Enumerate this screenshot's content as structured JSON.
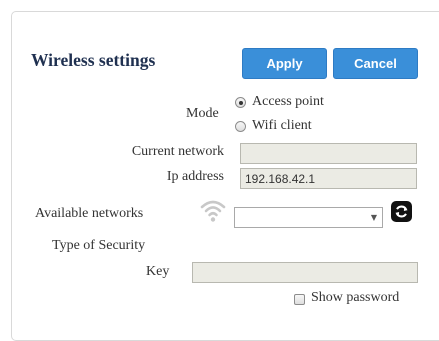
{
  "form": {
    "title": "Wireless settings",
    "apply_label": "Apply",
    "cancel_label": "Cancel",
    "mode_label": "Mode",
    "mode_options": [
      "Access point",
      "Wifi client"
    ],
    "mode_selected": "Access point",
    "current_network_label": "Current network",
    "current_network_value": "",
    "ip_address_label": "Ip address",
    "ip_address_value": "192.168.42.1",
    "available_networks_label": "Available networks",
    "available_networks_selected": "",
    "security_label": "Type of Security",
    "key_label": "Key",
    "key_value": "",
    "show_password_label": "Show password"
  },
  "icons": {
    "wifi": "wifi-icon",
    "refresh": "refresh-icon",
    "dropdown": "chevron-down-icon"
  },
  "colors": {
    "accent": "#3a8fd9",
    "title": "#1f3050",
    "field_disabled_bg": "#ebebe4"
  }
}
